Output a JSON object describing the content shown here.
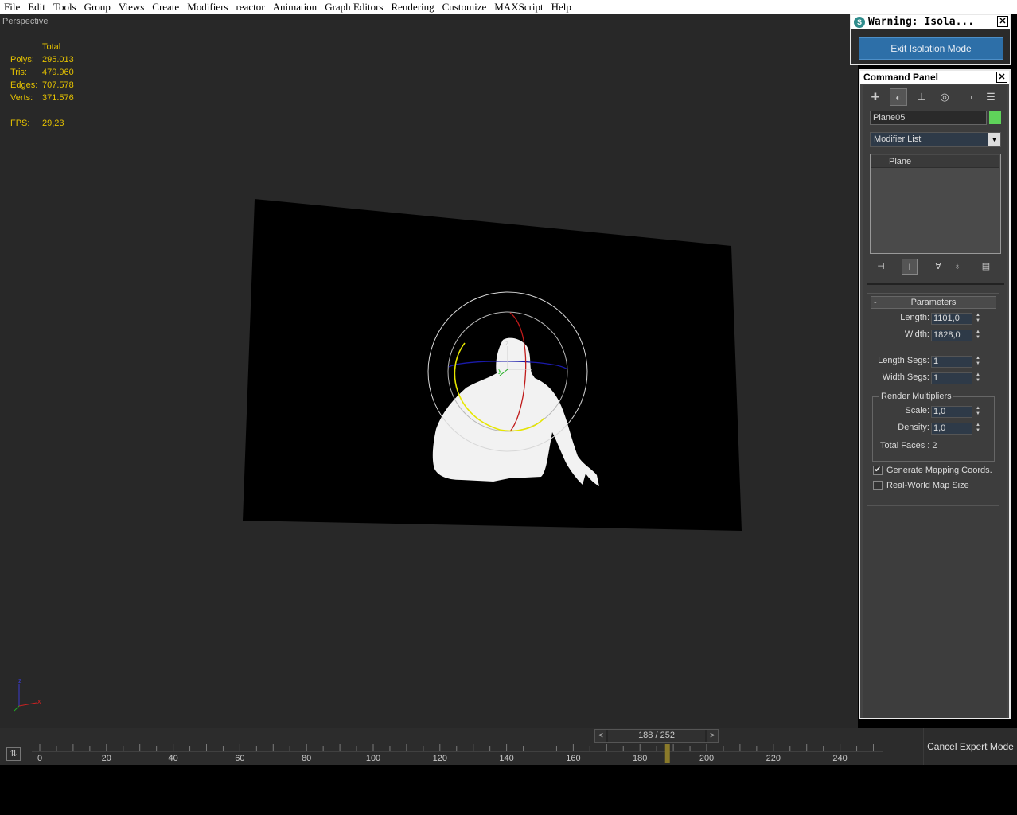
{
  "menu": [
    "File",
    "Edit",
    "Tools",
    "Group",
    "Views",
    "Create",
    "Modifiers",
    "reactor",
    "Animation",
    "Graph Editors",
    "Rendering",
    "Customize",
    "MAXScript",
    "Help"
  ],
  "viewport": {
    "label": "Perspective",
    "stats": {
      "header": "Total",
      "rows": [
        {
          "label": "Polys:",
          "value": "295.013"
        },
        {
          "label": "Tris:",
          "value": "479.960"
        },
        {
          "label": "Edges:",
          "value": "707.578"
        },
        {
          "label": "Verts:",
          "value": "371.576"
        }
      ],
      "fps_label": "FPS:",
      "fps_value": "29,23"
    },
    "gizmo_labels": {
      "z": "z",
      "y": "y"
    },
    "axis_labels": {
      "z": "z",
      "x": "x"
    }
  },
  "warning": {
    "title": "Warning: Isola...",
    "exit_button": "Exit Isolation Mode",
    "close": "✕"
  },
  "command_panel": {
    "title": "Command Panel",
    "close": "✕",
    "tabs": [
      "create-icon",
      "modify-icon",
      "hierarchy-icon",
      "motion-icon",
      "display-icon",
      "utilities-icon"
    ],
    "object_name": "Plane05",
    "object_color": "#5fd35a",
    "modifier_list": "Modifier List",
    "stack_item": "Plane",
    "parameters": {
      "header": "Parameters",
      "minus": "-",
      "length_label": "Length:",
      "length_value": "1101,0",
      "width_label": "Width:",
      "width_value": "1828,0",
      "length_segs_label": "Length Segs:",
      "length_segs_value": "1",
      "width_segs_label": "Width Segs:",
      "width_segs_value": "1",
      "render_multipliers": "Render Multipliers",
      "scale_label": "Scale:",
      "scale_value": "1,0",
      "density_label": "Density:",
      "density_value": "1,0",
      "total_faces": "Total Faces : 2",
      "gen_mapping": "Generate Mapping Coords.",
      "gen_mapping_checked": true,
      "real_world": "Real-World Map Size",
      "real_world_checked": false
    }
  },
  "timeline": {
    "frame": "188 / 252",
    "current_frame": 188,
    "total_frames": 252,
    "tick_labels": [
      "0",
      "20",
      "40",
      "60",
      "80",
      "100",
      "120",
      "140",
      "160",
      "180",
      "200",
      "220",
      "240"
    ],
    "cancel_expert": "Cancel Expert Mode"
  }
}
